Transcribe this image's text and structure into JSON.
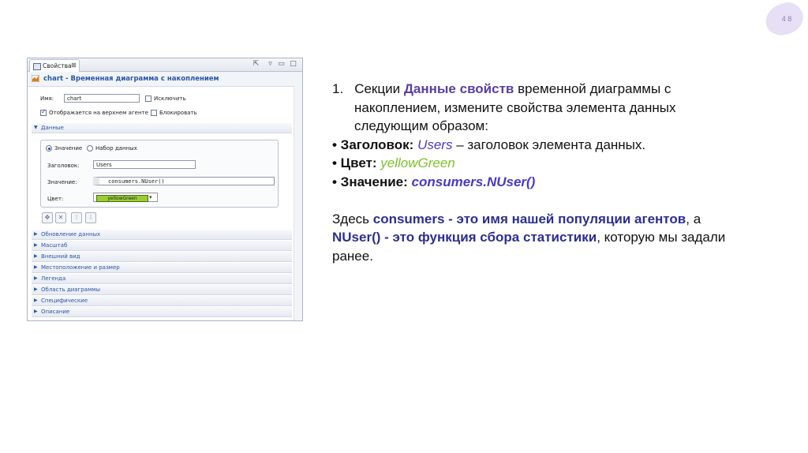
{
  "slide_number": "4 8",
  "panel": {
    "tab_label": "Свойства",
    "title": "chart - Временная диаграмма с накоплением",
    "name_label": "Имя:",
    "name_value": "chart",
    "exclude_label": "Исключить",
    "show_top_agent_label": "Отображается на верхнем агенте",
    "lock_label": "Блокировать",
    "data_section": "Данные",
    "radio_value": "Значение",
    "radio_dataset": "Набор данных",
    "title_label": "Заголовок:",
    "title_value": "Users",
    "value_label": "Значение:",
    "value_value": "consumers.NUser()",
    "color_label": "Цвет:",
    "color_value": "yellowGreen",
    "sections": [
      "Обновление данных",
      "Масштаб",
      "Внешний вид",
      "Местоположение и размер",
      "Легенда",
      "Область диаграммы",
      "Специфические",
      "Описание"
    ],
    "colors": {
      "title": "#2b56a8",
      "swatch": "#9acd32"
    }
  },
  "text": {
    "item_number": "1.",
    "line1_a": "Секции ",
    "line1_b": "Данные свойств",
    "line1_c": " временной диаграммы с",
    "line2": "накоплением, измените свойства элемента данных",
    "line3": "следующим образом:",
    "b1_label": "• Заголовок: ",
    "b1_value": "Users",
    "b1_rest": " – заголовок элемента данных.",
    "b2_label": "• Цвет: ",
    "b2_value": "yellowGreen",
    "b3_label": "• Значение: ",
    "b3_value": "consumers.NUser()",
    "p2_a": "Здесь ",
    "p2_b": "consumers - это имя нашей популяции агентов",
    "p2_c": ", а",
    "p3_a": "NUser() - это функция сбора статистики",
    "p3_b": ", которую мы задали",
    "p4": "ранее.",
    "colors": {
      "highlight": "#5a3fa0",
      "users": "#4a3ac0",
      "green": "#7cc229",
      "navy": "#2c2f8f"
    }
  }
}
